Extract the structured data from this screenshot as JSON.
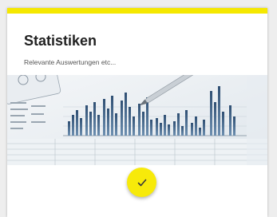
{
  "card": {
    "title": "Statistiken",
    "subtitle": "Relevante Auswertungen etc..."
  },
  "colors": {
    "accent": "#f5e800",
    "button": "#f7ea0a",
    "background": "#eeeeee"
  },
  "icons": {
    "action_button": "check-icon"
  },
  "hero_image": {
    "description_icon": "financial-bar-chart-photo"
  }
}
